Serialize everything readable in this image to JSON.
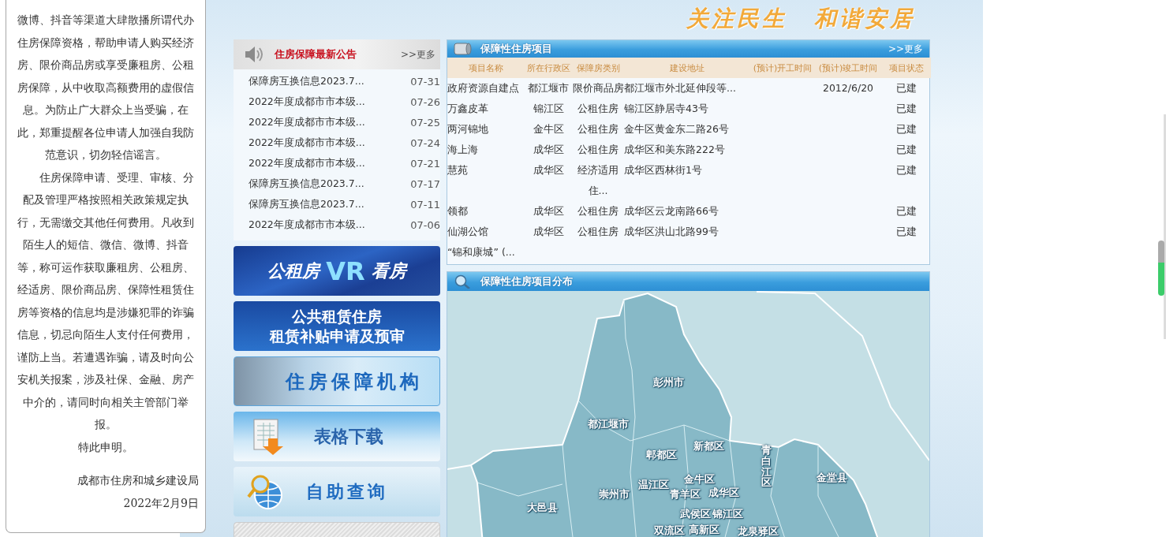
{
  "popup": {
    "paragraphs": [
      {
        "kind": "plain",
        "text": "微博、抖音等渠道大肆散播所谓代办住房保障资格，帮助申请人购买经济房、限价商品房或享受廉租房、公租房保障，从中收取高额费用的虚假信息。为防止广大群众上当受骗，在此，郑重提醒各位申请人加强自我防范意识，切勿轻信谣言。"
      },
      {
        "kind": "indented",
        "text": "住房保障申请、受理、审核、分配及管理严格按照相关政策规定执行，无需缴交其他任何费用。凡收到陌生人的短信、微信、微博、抖音等，称可运作获取廉租房、公租房、经适房、限价商品房、保障性租赁住房等资格的信息均是涉嫌犯罪的诈骗信息，切忌向陌生人支付任何费用，谨防上当。若遭遇诈骗，请及时向公安机关报案，涉及社保、金融、房产中介的，请同时向相关主管部门举报。"
      },
      {
        "kind": "plain",
        "text": "特此申明。"
      }
    ],
    "signature": "成都市住房和城乡建设局",
    "date": "2022年2月9日"
  },
  "header": {
    "slogan": [
      "关注民生",
      "和谐安居"
    ]
  },
  "notices": {
    "title": "住房保障最新公告",
    "more": ">>更多",
    "items": [
      {
        "title": "保障房互换信息2023.7...",
        "date": "07-31"
      },
      {
        "title": "2022年度成都市市本级...",
        "date": "07-26"
      },
      {
        "title": "2022年度成都市市本级...",
        "date": "07-25"
      },
      {
        "title": "2022年度成都市市本级...",
        "date": "07-24"
      },
      {
        "title": "2022年度成都市市本级...",
        "date": "07-21"
      },
      {
        "title": "保障房互换信息2023.7...",
        "date": "07-17"
      },
      {
        "title": "保障房互换信息2023.7...",
        "date": "07-11"
      },
      {
        "title": "2022年度成都市市本级...",
        "date": "07-06"
      }
    ]
  },
  "banners": [
    {
      "kind": "vr",
      "parts": [
        "公租房",
        "VR",
        "看房"
      ]
    },
    {
      "kind": "subsidy",
      "parts": [
        "公共租赁住房",
        "租赁补贴申请及预审"
      ]
    },
    {
      "kind": "agency",
      "parts": [
        "住房保障机构"
      ]
    },
    {
      "kind": "forms",
      "parts": [
        "表格下载"
      ]
    },
    {
      "kind": "query",
      "parts": [
        "自助查询"
      ]
    },
    {
      "kind": "strip"
    }
  ],
  "projects": {
    "title": "保障性住房项目",
    "more": ">>更多",
    "columns": [
      "项目名称",
      "所在行政区",
      "保障房类别",
      "建设地址",
      "(预计)开工时间",
      "(预计)竣工时间",
      "项目状态"
    ],
    "rows": [
      {
        "name": "政府资源自建点",
        "district": "都江堰市",
        "type": "限价商品房",
        "address": "都江堰市外北延伸段等...",
        "end": "2012/6/20",
        "status": "已建"
      },
      {
        "name": "万鑫皮革",
        "district": "锦江区",
        "type": "公租住房",
        "address": "锦江区静居寺43号",
        "status": "已建"
      },
      {
        "name": "两河锦地",
        "district": "金牛区",
        "type": "公租住房",
        "address": "金牛区黄金东二路26号",
        "status": "已建"
      },
      {
        "name": "海上海",
        "district": "成华区",
        "type": "公租住房",
        "address": "成华区和美东路222号",
        "status": "已建"
      },
      {
        "name": "慧苑",
        "district": "成华区",
        "type": "经济适用住...",
        "address": "成华区西林街1号",
        "status": "已建"
      },
      {
        "name": "领都",
        "district": "成华区",
        "type": "公租住房",
        "address": "成华区云龙南路66号",
        "status": "已建"
      },
      {
        "name": "仙湖公馆",
        "district": "成华区",
        "type": "公租住房",
        "address": "成华区洪山北路99号",
        "status": "已建"
      },
      {
        "name": "“锦和康城”  (..."
      }
    ]
  },
  "map": {
    "title": "保障性住房项目分布",
    "labels": [
      {
        "name": "彭州市",
        "kind": "horizontal"
      },
      {
        "name": "都江堰市",
        "kind": "horizontal"
      },
      {
        "name": "郫都区",
        "kind": "horizontal"
      },
      {
        "name": "新都区",
        "kind": "horizontal"
      },
      {
        "name": "温江区",
        "kind": "horizontal"
      },
      {
        "name": "金牛区",
        "kind": "horizontal"
      },
      {
        "name": "青白江区",
        "kind": "vertical"
      },
      {
        "name": "金堂县",
        "kind": "horizontal"
      },
      {
        "name": "大邑县",
        "kind": "horizontal"
      },
      {
        "name": "崇州市",
        "kind": "horizontal"
      },
      {
        "name": "青羊区",
        "kind": "horizontal"
      },
      {
        "name": "成华区",
        "kind": "horizontal"
      },
      {
        "name": "武侯区",
        "kind": "horizontal"
      },
      {
        "name": "锦江区",
        "kind": "horizontal"
      },
      {
        "name": "双流区",
        "kind": "horizontal"
      },
      {
        "name": "高新区",
        "kind": "horizontal"
      },
      {
        "name": "龙泉驿区",
        "kind": "horizontal"
      }
    ]
  }
}
